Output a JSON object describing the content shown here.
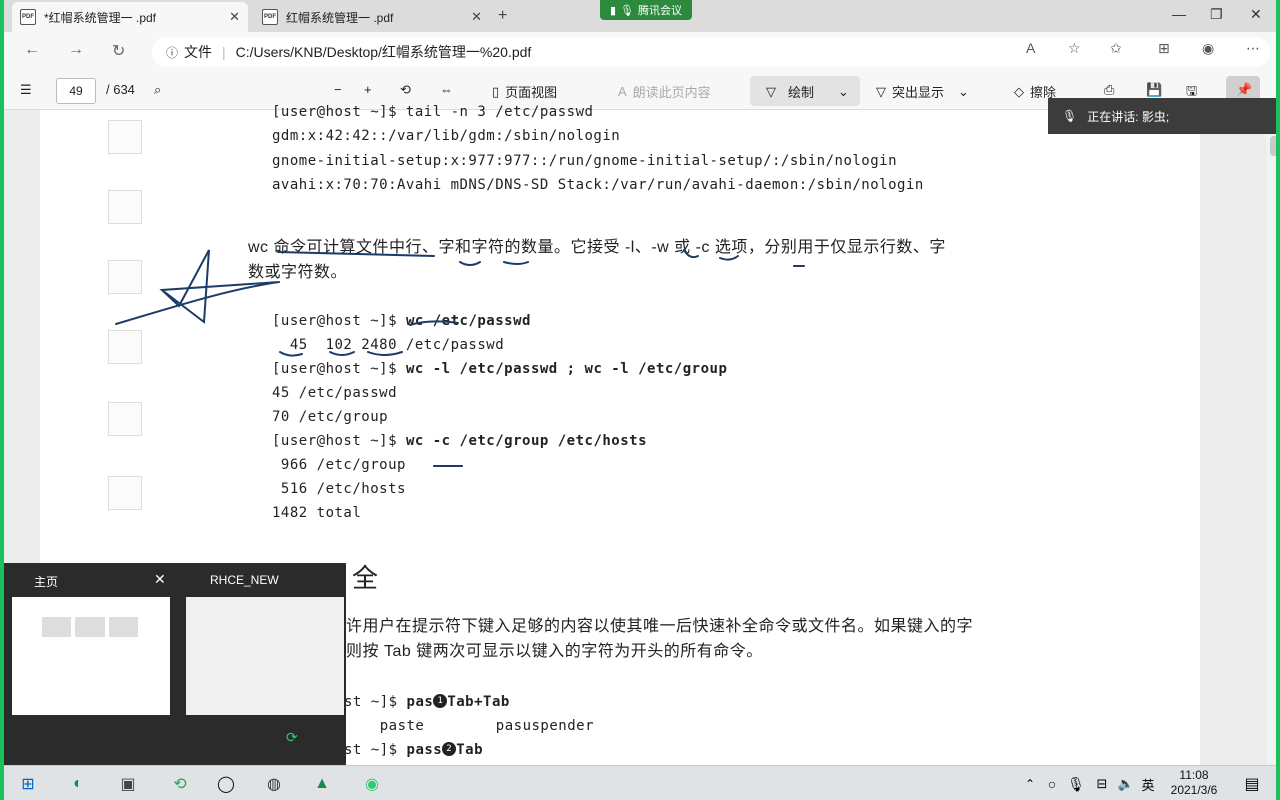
{
  "browser": {
    "tabs": [
      {
        "label": "*红帽系统管理一 .pdf",
        "icon": "pdf-icon"
      },
      {
        "label": "红帽系统管理一 .pdf",
        "icon": "pdf-icon"
      }
    ],
    "meeting_label": "腾讯会议",
    "address": {
      "info_label": "文件",
      "url": "C:/Users/KNB/Desktop/红帽系统管理一%20.pdf"
    }
  },
  "pdf_toolbar": {
    "page_number": "49",
    "page_total": "/ 634",
    "page_view_label": "页面视图",
    "read_aloud_label": "朗读此页内容",
    "draw_label": "绘制",
    "highlight_label": "突出显示",
    "erase_label": "擦除"
  },
  "speaking_notice": "正在讲话: 影虫;",
  "document": {
    "code_top": [
      "[user@host ~]$ tail -n 3 /etc/passwd",
      "gdm:x:42:42::/var/lib/gdm:/sbin/nologin",
      "gnome-initial-setup:x:977:977::/run/gnome-initial-setup/:/sbin/nologin",
      "avahi:x:70:70:Avahi mDNS/DNS-SD Stack:/var/run/avahi-daemon:/sbin/nologin"
    ],
    "wc_para_line1": "wc 命令可计算文件中行、字和字符的数量。它接受 -l、-w 或 -c 选项，分别用于仅显示行数、字",
    "wc_para_line2": "数或字符数。",
    "code_wc": [
      {
        "prompt": "[user@host ~]$ ",
        "cmd": "wc /etc/passwd"
      },
      {
        "text": "  45  102 2480 /etc/passwd"
      },
      {
        "prompt": "[user@host ~]$ ",
        "cmd": "wc -l /etc/passwd ; wc -l /etc/group"
      },
      {
        "text": "45 /etc/passwd"
      },
      {
        "text": "70 /etc/group"
      },
      {
        "prompt": "[user@host ~]$ ",
        "cmd": "wc -c /etc/group /etc/hosts"
      },
      {
        "text": " 966 /etc/group"
      },
      {
        "text": " 516 /etc/hosts"
      },
      {
        "text": "1482 total"
      }
    ],
    "section_heading_tail": "全",
    "tab_para_line1": "许用户在提示符下键入足够的内容以使其唯一后快速补全命令或文件名。如果键入的字",
    "tab_para_line2": "则按 Tab 键两次可显示以键入的字符为开头的所有命令。",
    "code_tab": [
      {
        "prompt": "st ~]$ ",
        "cmd": "pas",
        "marker": "1",
        "after": "Tab+Tab"
      },
      {
        "text": "    paste        pasuspender"
      },
      {
        "prompt": "st ~]$ ",
        "cmd": "pass",
        "marker": "2",
        "after": "Tab"
      }
    ]
  },
  "switcher": {
    "tab1_label": "主页",
    "tab2_label": "RHCE_NEW"
  },
  "taskbar": {
    "ime_label": "英",
    "time": "11:08",
    "date": "2021/3/6"
  }
}
